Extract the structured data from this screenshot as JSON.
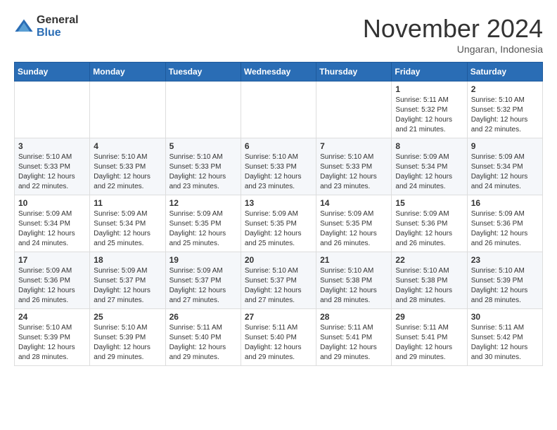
{
  "header": {
    "logo_general": "General",
    "logo_blue": "Blue",
    "month_title": "November 2024",
    "location": "Ungaran, Indonesia"
  },
  "days_of_week": [
    "Sunday",
    "Monday",
    "Tuesday",
    "Wednesday",
    "Thursday",
    "Friday",
    "Saturday"
  ],
  "weeks": [
    [
      {
        "day": "",
        "info": ""
      },
      {
        "day": "",
        "info": ""
      },
      {
        "day": "",
        "info": ""
      },
      {
        "day": "",
        "info": ""
      },
      {
        "day": "",
        "info": ""
      },
      {
        "day": "1",
        "info": "Sunrise: 5:11 AM\nSunset: 5:32 PM\nDaylight: 12 hours and 21 minutes."
      },
      {
        "day": "2",
        "info": "Sunrise: 5:10 AM\nSunset: 5:32 PM\nDaylight: 12 hours and 22 minutes."
      }
    ],
    [
      {
        "day": "3",
        "info": "Sunrise: 5:10 AM\nSunset: 5:33 PM\nDaylight: 12 hours and 22 minutes."
      },
      {
        "day": "4",
        "info": "Sunrise: 5:10 AM\nSunset: 5:33 PM\nDaylight: 12 hours and 22 minutes."
      },
      {
        "day": "5",
        "info": "Sunrise: 5:10 AM\nSunset: 5:33 PM\nDaylight: 12 hours and 23 minutes."
      },
      {
        "day": "6",
        "info": "Sunrise: 5:10 AM\nSunset: 5:33 PM\nDaylight: 12 hours and 23 minutes."
      },
      {
        "day": "7",
        "info": "Sunrise: 5:10 AM\nSunset: 5:33 PM\nDaylight: 12 hours and 23 minutes."
      },
      {
        "day": "8",
        "info": "Sunrise: 5:09 AM\nSunset: 5:34 PM\nDaylight: 12 hours and 24 minutes."
      },
      {
        "day": "9",
        "info": "Sunrise: 5:09 AM\nSunset: 5:34 PM\nDaylight: 12 hours and 24 minutes."
      }
    ],
    [
      {
        "day": "10",
        "info": "Sunrise: 5:09 AM\nSunset: 5:34 PM\nDaylight: 12 hours and 24 minutes."
      },
      {
        "day": "11",
        "info": "Sunrise: 5:09 AM\nSunset: 5:34 PM\nDaylight: 12 hours and 25 minutes."
      },
      {
        "day": "12",
        "info": "Sunrise: 5:09 AM\nSunset: 5:35 PM\nDaylight: 12 hours and 25 minutes."
      },
      {
        "day": "13",
        "info": "Sunrise: 5:09 AM\nSunset: 5:35 PM\nDaylight: 12 hours and 25 minutes."
      },
      {
        "day": "14",
        "info": "Sunrise: 5:09 AM\nSunset: 5:35 PM\nDaylight: 12 hours and 26 minutes."
      },
      {
        "day": "15",
        "info": "Sunrise: 5:09 AM\nSunset: 5:36 PM\nDaylight: 12 hours and 26 minutes."
      },
      {
        "day": "16",
        "info": "Sunrise: 5:09 AM\nSunset: 5:36 PM\nDaylight: 12 hours and 26 minutes."
      }
    ],
    [
      {
        "day": "17",
        "info": "Sunrise: 5:09 AM\nSunset: 5:36 PM\nDaylight: 12 hours and 26 minutes."
      },
      {
        "day": "18",
        "info": "Sunrise: 5:09 AM\nSunset: 5:37 PM\nDaylight: 12 hours and 27 minutes."
      },
      {
        "day": "19",
        "info": "Sunrise: 5:09 AM\nSunset: 5:37 PM\nDaylight: 12 hours and 27 minutes."
      },
      {
        "day": "20",
        "info": "Sunrise: 5:10 AM\nSunset: 5:37 PM\nDaylight: 12 hours and 27 minutes."
      },
      {
        "day": "21",
        "info": "Sunrise: 5:10 AM\nSunset: 5:38 PM\nDaylight: 12 hours and 28 minutes."
      },
      {
        "day": "22",
        "info": "Sunrise: 5:10 AM\nSunset: 5:38 PM\nDaylight: 12 hours and 28 minutes."
      },
      {
        "day": "23",
        "info": "Sunrise: 5:10 AM\nSunset: 5:39 PM\nDaylight: 12 hours and 28 minutes."
      }
    ],
    [
      {
        "day": "24",
        "info": "Sunrise: 5:10 AM\nSunset: 5:39 PM\nDaylight: 12 hours and 28 minutes."
      },
      {
        "day": "25",
        "info": "Sunrise: 5:10 AM\nSunset: 5:39 PM\nDaylight: 12 hours and 29 minutes."
      },
      {
        "day": "26",
        "info": "Sunrise: 5:11 AM\nSunset: 5:40 PM\nDaylight: 12 hours and 29 minutes."
      },
      {
        "day": "27",
        "info": "Sunrise: 5:11 AM\nSunset: 5:40 PM\nDaylight: 12 hours and 29 minutes."
      },
      {
        "day": "28",
        "info": "Sunrise: 5:11 AM\nSunset: 5:41 PM\nDaylight: 12 hours and 29 minutes."
      },
      {
        "day": "29",
        "info": "Sunrise: 5:11 AM\nSunset: 5:41 PM\nDaylight: 12 hours and 29 minutes."
      },
      {
        "day": "30",
        "info": "Sunrise: 5:11 AM\nSunset: 5:42 PM\nDaylight: 12 hours and 30 minutes."
      }
    ]
  ]
}
